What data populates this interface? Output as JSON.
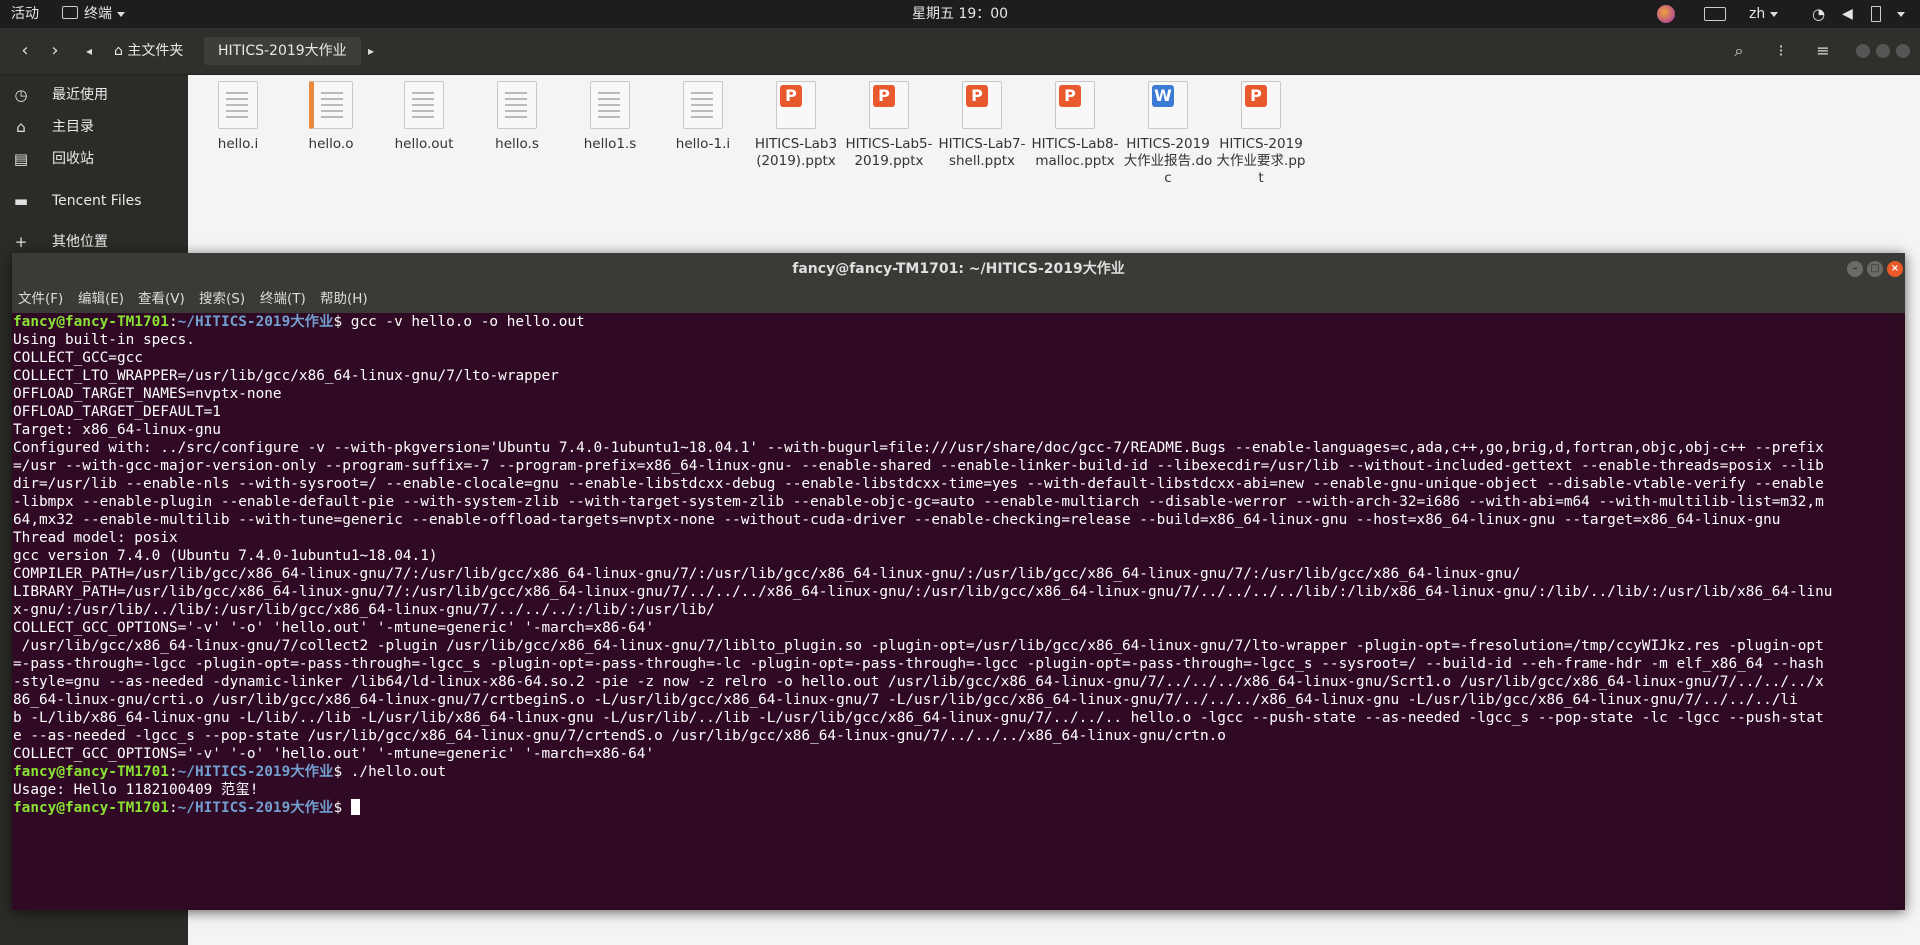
{
  "topbar": {
    "activities": "活动",
    "app_menu": "终端",
    "clock": "星期五 19：00",
    "lang": "zh"
  },
  "file_manager": {
    "breadcrumb_home": "主文件夹",
    "breadcrumb_current": "HITICS-2019大作业",
    "sidebar": [
      {
        "label": "最近使用",
        "icon": "clock-icon"
      },
      {
        "label": "主目录",
        "icon": "home-icon"
      },
      {
        "label": "回收站",
        "icon": "trash-icon"
      },
      {
        "label": "Tencent Files",
        "icon": "folder-icon"
      },
      {
        "label": "其他位置",
        "icon": "plus-icon"
      }
    ],
    "files": [
      {
        "name": "hello.i",
        "type": "text"
      },
      {
        "name": "hello.o",
        "type": "object"
      },
      {
        "name": "hello.out",
        "type": "text"
      },
      {
        "name": "hello.s",
        "type": "text"
      },
      {
        "name": "hello1.s",
        "type": "text"
      },
      {
        "name": "hello-1.i",
        "type": "text"
      },
      {
        "name": "HITICS-Lab3(2019).pptx",
        "type": "pptx"
      },
      {
        "name": "HITICS-Lab5-2019.pptx",
        "type": "pptx"
      },
      {
        "name": "HITICS-Lab7-shell.pptx",
        "type": "pptx"
      },
      {
        "name": "HITICS-Lab8-malloc.pptx",
        "type": "pptx"
      },
      {
        "name": "HITICS-2019大作业报告.doc",
        "type": "doc"
      },
      {
        "name": "HITICS-2019大作业要求.ppt",
        "type": "ppt"
      }
    ]
  },
  "terminal": {
    "title": "fancy@fancy-TM1701: ~/HITICS-2019大作业",
    "menu": [
      "文件(F)",
      "编辑(E)",
      "查看(V)",
      "搜索(S)",
      "终端(T)",
      "帮助(H)"
    ],
    "prompt_user": "fancy@fancy-TM1701",
    "prompt_path": "~/HITICS-2019大作业",
    "command1": "$ gcc -v hello.o -o hello.out",
    "output1": "Using built-in specs.\nCOLLECT_GCC=gcc\nCOLLECT_LTO_WRAPPER=/usr/lib/gcc/x86_64-linux-gnu/7/lto-wrapper\nOFFLOAD_TARGET_NAMES=nvptx-none\nOFFLOAD_TARGET_DEFAULT=1\nTarget: x86_64-linux-gnu\nConfigured with: ../src/configure -v --with-pkgversion='Ubuntu 7.4.0-1ubuntu1~18.04.1' --with-bugurl=file:///usr/share/doc/gcc-7/README.Bugs --enable-languages=c,ada,c++,go,brig,d,fortran,objc,obj-c++ --prefix\n=/usr --with-gcc-major-version-only --program-suffix=-7 --program-prefix=x86_64-linux-gnu- --enable-shared --enable-linker-build-id --libexecdir=/usr/lib --without-included-gettext --enable-threads=posix --lib\ndir=/usr/lib --enable-nls --with-sysroot=/ --enable-clocale=gnu --enable-libstdcxx-debug --enable-libstdcxx-time=yes --with-default-libstdcxx-abi=new --enable-gnu-unique-object --disable-vtable-verify --enable\n-libmpx --enable-plugin --enable-default-pie --with-system-zlib --with-target-system-zlib --enable-objc-gc=auto --enable-multiarch --disable-werror --with-arch-32=i686 --with-abi=m64 --with-multilib-list=m32,m\n64,mx32 --enable-multilib --with-tune=generic --enable-offload-targets=nvptx-none --without-cuda-driver --enable-checking=release --build=x86_64-linux-gnu --host=x86_64-linux-gnu --target=x86_64-linux-gnu\nThread model: posix\ngcc version 7.4.0 (Ubuntu 7.4.0-1ubuntu1~18.04.1)\nCOMPILER_PATH=/usr/lib/gcc/x86_64-linux-gnu/7/:/usr/lib/gcc/x86_64-linux-gnu/7/:/usr/lib/gcc/x86_64-linux-gnu/:/usr/lib/gcc/x86_64-linux-gnu/7/:/usr/lib/gcc/x86_64-linux-gnu/\nLIBRARY_PATH=/usr/lib/gcc/x86_64-linux-gnu/7/:/usr/lib/gcc/x86_64-linux-gnu/7/../../../x86_64-linux-gnu/:/usr/lib/gcc/x86_64-linux-gnu/7/../../../../lib/:/lib/x86_64-linux-gnu/:/lib/../lib/:/usr/lib/x86_64-linu\nx-gnu/:/usr/lib/../lib/:/usr/lib/gcc/x86_64-linux-gnu/7/../../../:/lib/:/usr/lib/\nCOLLECT_GCC_OPTIONS='-v' '-o' 'hello.out' '-mtune=generic' '-march=x86-64'\n /usr/lib/gcc/x86_64-linux-gnu/7/collect2 -plugin /usr/lib/gcc/x86_64-linux-gnu/7/liblto_plugin.so -plugin-opt=/usr/lib/gcc/x86_64-linux-gnu/7/lto-wrapper -plugin-opt=-fresolution=/tmp/ccyWIJkz.res -plugin-opt\n=-pass-through=-lgcc -plugin-opt=-pass-through=-lgcc_s -plugin-opt=-pass-through=-lc -plugin-opt=-pass-through=-lgcc -plugin-opt=-pass-through=-lgcc_s --sysroot=/ --build-id --eh-frame-hdr -m elf_x86_64 --hash\n-style=gnu --as-needed -dynamic-linker /lib64/ld-linux-x86-64.so.2 -pie -z now -z relro -o hello.out /usr/lib/gcc/x86_64-linux-gnu/7/../../../x86_64-linux-gnu/Scrt1.o /usr/lib/gcc/x86_64-linux-gnu/7/../../../x\n86_64-linux-gnu/crti.o /usr/lib/gcc/x86_64-linux-gnu/7/crtbeginS.o -L/usr/lib/gcc/x86_64-linux-gnu/7 -L/usr/lib/gcc/x86_64-linux-gnu/7/../../../x86_64-linux-gnu -L/usr/lib/gcc/x86_64-linux-gnu/7/../../../li\nb -L/lib/x86_64-linux-gnu -L/lib/../lib -L/usr/lib/x86_64-linux-gnu -L/usr/lib/../lib -L/usr/lib/gcc/x86_64-linux-gnu/7/../../.. hello.o -lgcc --push-state --as-needed -lgcc_s --pop-state -lc -lgcc --push-stat\ne --as-needed -lgcc_s --pop-state /usr/lib/gcc/x86_64-linux-gnu/7/crtendS.o /usr/lib/gcc/x86_64-linux-gnu/7/../../../x86_64-linux-gnu/crtn.o\nCOLLECT_GCC_OPTIONS='-v' '-o' 'hello.out' '-mtune=generic' '-march=x86-64'",
    "command2": "$ ./hello.out",
    "output2": "Usage: Hello 1182100409 范玺!",
    "prompt3_suffix": "$ "
  },
  "colors": {
    "terminal_bg": "#300a24",
    "prompt_user": "#8ae234",
    "prompt_path": "#729fcf"
  }
}
